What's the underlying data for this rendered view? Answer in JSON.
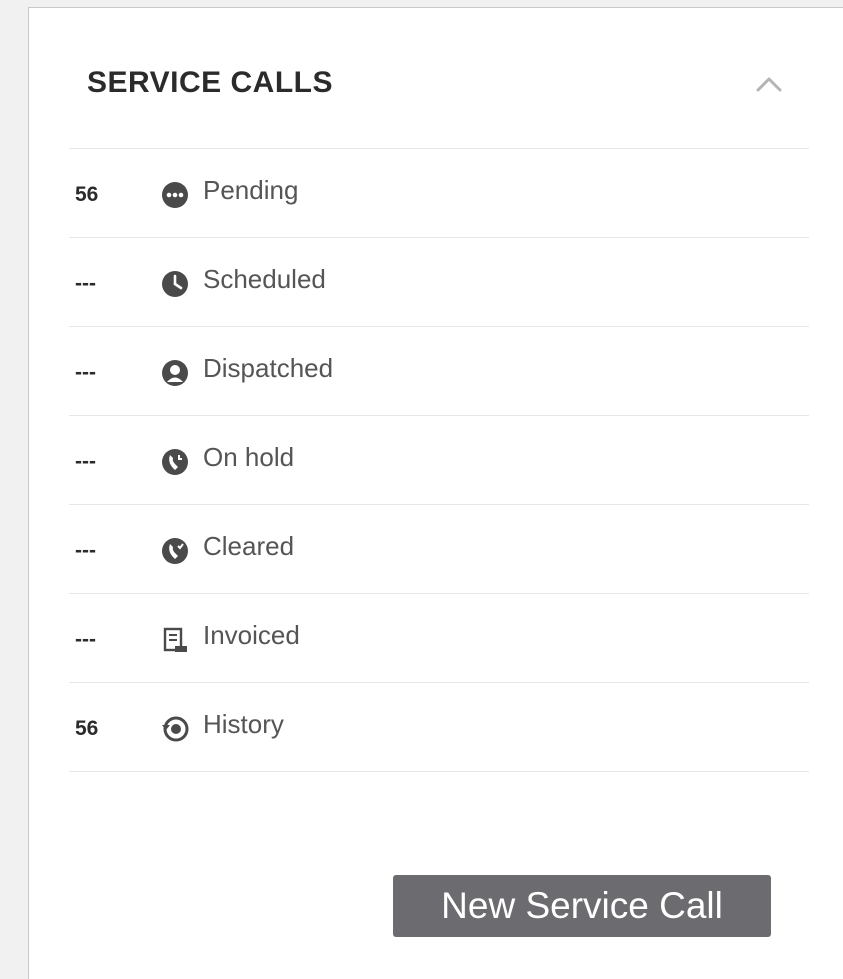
{
  "panel": {
    "title": "SERVICE CALLS"
  },
  "items": [
    {
      "count": "56",
      "label": "Pending",
      "icon": "ellipsis-circle-icon"
    },
    {
      "count": "---",
      "label": "Scheduled",
      "icon": "clock-icon"
    },
    {
      "count": "---",
      "label": "Dispatched",
      "icon": "technician-icon"
    },
    {
      "count": "---",
      "label": "On hold",
      "icon": "phone-hold-icon"
    },
    {
      "count": "---",
      "label": "Cleared",
      "icon": "phone-cleared-icon"
    },
    {
      "count": "---",
      "label": "Invoiced",
      "icon": "invoice-scroll-icon"
    },
    {
      "count": "56",
      "label": "History",
      "icon": "history-icon"
    }
  ],
  "actions": {
    "new_label": "New Service Call"
  },
  "colors": {
    "button_bg": "#6c6c70",
    "icon": "#4a4a4a",
    "text": "#555555"
  }
}
